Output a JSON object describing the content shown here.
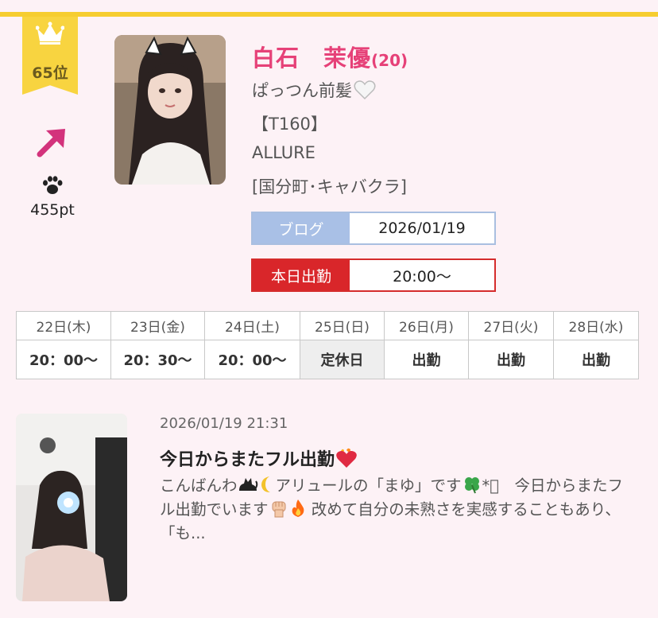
{
  "ranking": {
    "rank": "65位",
    "points": "455pt",
    "trend_icon": "arrow-up-right-icon",
    "badge_color": "#f8d440"
  },
  "profile": {
    "name": "白石　茉優",
    "age": "(20)",
    "catchphrase": "ぱっつん前髪",
    "height": "【T160】",
    "shop": "ALLURE",
    "area_category": "[国分町･キャバクラ]",
    "name_color": "#e64178"
  },
  "blog": {
    "label": "ブログ",
    "date": "2026/01/19"
  },
  "today": {
    "label": "本日出勤",
    "time": "20:00〜"
  },
  "schedule": {
    "days": [
      "22日(木)",
      "23日(金)",
      "24日(土)",
      "25日(日)",
      "26日(月)",
      "27日(火)",
      "28日(水)"
    ],
    "times": [
      "20：00〜",
      "20：30〜",
      "20：00〜",
      "定休日",
      "出勤",
      "出勤",
      "出勤"
    ]
  },
  "post": {
    "datetime": "2026/01/19 21:31",
    "title": "今日からまたフル出勤",
    "body_1": "こんばんわ",
    "body_2": "アリュールの「まゆ」です",
    "body_3": "*ﾟ　今日からまたフル出勤でいます",
    "body_4": " 改めて自分の未熟さを実感することもあり、「も..."
  }
}
